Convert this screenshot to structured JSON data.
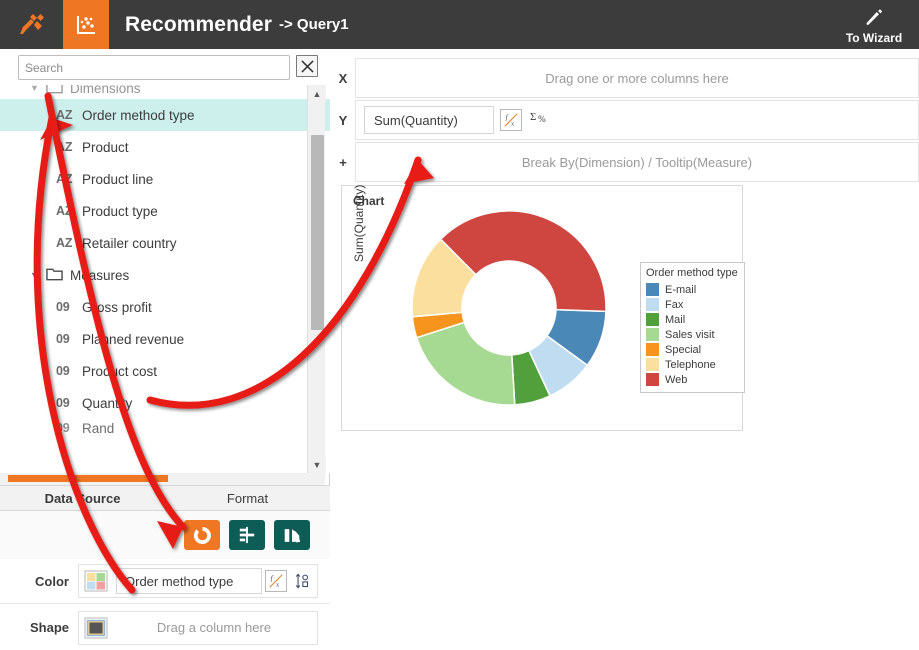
{
  "header": {
    "logo_icon": "tools-pencil-icon",
    "tab_icon": "scatter-chart-icon",
    "title_main": "Recommender",
    "title_sub": "-> Query1",
    "wizard_icon": "pencil-icon",
    "wizard_label": "To Wizard",
    "bg_color": "#3c3c3c",
    "accent_color": "#ef7622"
  },
  "search": {
    "placeholder": "Search",
    "value": "",
    "clear_icon": "close-box-icon"
  },
  "tree": {
    "rows": [
      {
        "label": "Dimensions",
        "kind": "folder",
        "icon": "folder-icon",
        "caret": "▼",
        "clipped": true,
        "selected": false
      },
      {
        "label": "Order method type",
        "kind": "field",
        "icon": "AZ",
        "caret": "",
        "clipped": false,
        "selected": true
      },
      {
        "label": "Product",
        "kind": "field",
        "icon": "AZ",
        "caret": "",
        "clipped": false,
        "selected": false
      },
      {
        "label": "Product line",
        "kind": "field",
        "icon": "AZ",
        "caret": "",
        "clipped": false,
        "selected": false
      },
      {
        "label": "Product type",
        "kind": "field",
        "icon": "AZ",
        "caret": "",
        "clipped": false,
        "selected": false
      },
      {
        "label": "Retailer country",
        "kind": "field",
        "icon": "AZ",
        "caret": "",
        "clipped": false,
        "selected": false
      },
      {
        "label": "Measures",
        "kind": "folder",
        "icon": "folder-icon",
        "caret": "▼",
        "clipped": false,
        "selected": false
      },
      {
        "label": "Gross profit",
        "kind": "field",
        "icon": "09",
        "caret": "",
        "clipped": false,
        "selected": false
      },
      {
        "label": "Planned revenue",
        "kind": "field",
        "icon": "09",
        "caret": "",
        "clipped": false,
        "selected": false
      },
      {
        "label": "Product cost",
        "kind": "field",
        "icon": "09",
        "caret": "",
        "clipped": false,
        "selected": false
      },
      {
        "label": "Quantity",
        "kind": "field",
        "icon": "09",
        "caret": "",
        "clipped": false,
        "selected": false
      },
      {
        "label": "Rand",
        "kind": "field",
        "icon": "09",
        "caret": "",
        "clipped": true,
        "selected": false
      }
    ],
    "scroll_up_icon": "triangle-up-icon",
    "scroll_down_icon": "triangle-down-icon"
  },
  "panel_tabs": [
    {
      "label": "Data Source",
      "active": true
    },
    {
      "label": "Format",
      "active": false
    }
  ],
  "tools": [
    {
      "name": "donut-chart-button",
      "icon": "donut-chart-icon",
      "style": "orange"
    },
    {
      "name": "bar-chart-button",
      "icon": "bar-chart-icon",
      "style": "teal"
    },
    {
      "name": "swap-axes-button",
      "icon": "swap-rotate-icon",
      "style": "teal"
    }
  ],
  "encodings": [
    {
      "label": "Color",
      "swatch_icon": "color-palette-icon",
      "value": "Order method type",
      "placeholder": "",
      "fx_icon": "fx-icon",
      "extra_icon": "sort-order-icon",
      "filled": true
    },
    {
      "label": "Shape",
      "swatch_icon": "shape-square-icon",
      "value": "",
      "placeholder": "Drag a column here",
      "fx_icon": "",
      "extra_icon": "",
      "filled": false
    }
  ],
  "shelves": [
    {
      "key": "X",
      "hint": "Drag one or more columns here",
      "pill": "",
      "has_pill": false,
      "fx_icon": "",
      "sigma_icon": ""
    },
    {
      "key": "Y",
      "hint": "",
      "pill": "Sum(Quantity)",
      "has_pill": true,
      "fx_icon": "fx-icon",
      "sigma_icon": "sigma-percent-icon"
    },
    {
      "key": "+",
      "hint": "Break By(Dimension) / Tooltip(Measure)",
      "pill": "",
      "has_pill": false,
      "fx_icon": "",
      "sigma_icon": ""
    }
  ],
  "chart_panel": {
    "title": "Chart",
    "y_axis_label": "Sum(Quantity)",
    "legend_title": "Order method type"
  },
  "chart_data": {
    "type": "pie",
    "variant": "donut",
    "title": "Chart",
    "ylabel": "Sum(Quantity)",
    "legend_title": "Order method type",
    "legend_position": "right",
    "categories": [
      "E-mail",
      "Fax",
      "Mail",
      "Sales visit",
      "Special",
      "Telephone",
      "Web"
    ],
    "values": [
      9.5,
      8.0,
      6.0,
      21.0,
      3.5,
      14.0,
      38.0
    ],
    "unit": "percent",
    "colors": [
      "#4a88b8",
      "#bfdcf0",
      "#52a03c",
      "#a6d991",
      "#f7941e",
      "#fbdf9e",
      "#cf4540"
    ]
  },
  "annotations": {
    "arrow_color": "#e81c18",
    "arrows": [
      {
        "name": "arrow-to-order-method-type"
      },
      {
        "name": "arrow-to-sum-quantity"
      },
      {
        "name": "arrow-to-color-field"
      }
    ]
  }
}
